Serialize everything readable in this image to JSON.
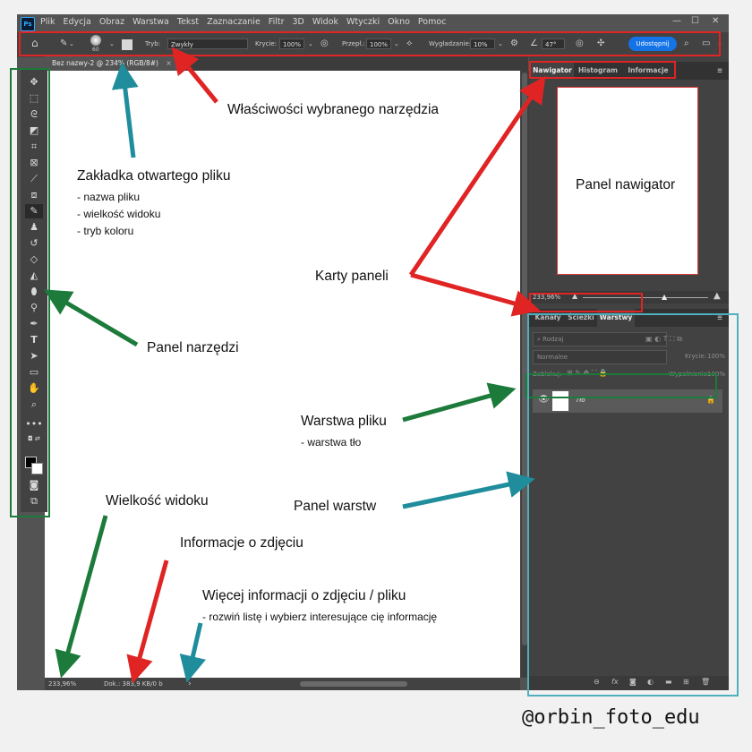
{
  "app": {
    "logo": "Ps",
    "menu": [
      "Plik",
      "Edycja",
      "Obraz",
      "Warstwa",
      "Tekst",
      "Zaznaczanie",
      "Filtr",
      "3D",
      "Widok",
      "Wtyczki",
      "Okno",
      "Pomoc"
    ],
    "window_controls": {
      "minimize": "—",
      "maximize": "☐",
      "close": "✕"
    }
  },
  "options_bar": {
    "brush_size": "60",
    "mode_label": "Tryb:",
    "mode_value": "Zwykły",
    "opacity_label": "Krycie:",
    "opacity_value": "100%",
    "flow_label": "Przepł.:",
    "flow_value": "100%",
    "smoothing_label": "Wygładzanie:",
    "smoothing_value": "10%",
    "angle_value": "47°",
    "share_label": "Udostępnij"
  },
  "document": {
    "tab_title": "Bez nazwy-2 @ 234% (RGB/8#)",
    "tab_close": "×",
    "zoom": "233,96%",
    "doc_info": "Dok.: 383,9 KB/0 b",
    "status_arrow": "›"
  },
  "navigator_panel": {
    "tabs": [
      "Nawigator",
      "Histogram",
      "Informacje"
    ],
    "zoom": "233,96%"
  },
  "layers_panel": {
    "tabs": [
      "Kanały",
      "Ścieżki",
      "Warstwy"
    ],
    "filter_placeholder": "Rodzaj",
    "blend_mode": "Normalne",
    "opacity_label": "Krycie:",
    "opacity_value": "100%",
    "lock_label": "Zablokuj:",
    "fill_label": "Wypełnienie:",
    "fill_value": "100%",
    "layer_name": "Tło"
  },
  "annotations": {
    "tool_properties": "Właściwości wybranego narzędzia",
    "file_tab": "Zakładka otwartego pliku",
    "file_tab_items": [
      "- nazwa pliku",
      "- wielkość widoku",
      "- tryb koloru"
    ],
    "navigator": "Panel nawigator",
    "panel_tabs": "Karty paneli",
    "tools_panel": "Panel narzędzi",
    "file_layer": "Warstwa pliku",
    "file_layer_sub": "- warstwa tło",
    "layers_panel": "Panel warstw",
    "view_size": "Wielkość widoku",
    "image_info": "Informacje o zdjęciu",
    "more_info": "Więcej informacji o zdjęciu / pliku",
    "more_info_sub": "- rozwiń listę i wybierz interesujące cię informację",
    "brand": "@orbin_foto_edu"
  },
  "colors": {
    "red": "#e02424",
    "green": "#1c7a3a",
    "teal": "#1f8d9b",
    "accent_blue": "#1473e6"
  }
}
